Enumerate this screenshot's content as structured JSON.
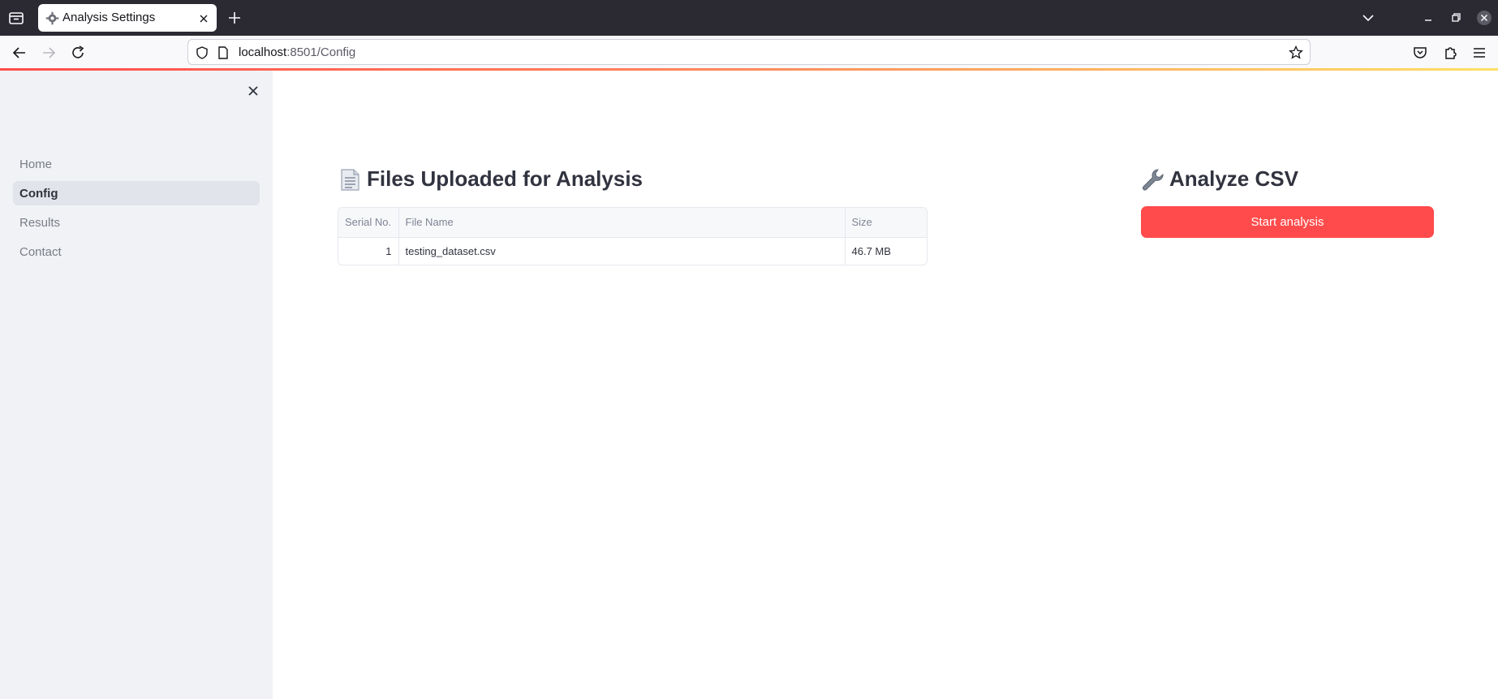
{
  "browser": {
    "tab_title": "Analysis Settings",
    "url_host": "localhost",
    "url_rest": ":8501/Config"
  },
  "sidebar": {
    "items": [
      {
        "label": "Home",
        "active": false
      },
      {
        "label": "Config",
        "active": true
      },
      {
        "label": "Results",
        "active": false
      },
      {
        "label": "Contact",
        "active": false
      }
    ]
  },
  "files_section": {
    "title": "Files Uploaded for Analysis",
    "icon": "page-icon",
    "columns": [
      "Serial No.",
      "File Name",
      "Size"
    ],
    "rows": [
      {
        "serial": "1",
        "name": "testing_dataset.csv",
        "size": "46.7 MB"
      }
    ]
  },
  "analyze_section": {
    "title": "Analyze CSV",
    "icon": "wrench-icon",
    "button_label": "Start analysis"
  },
  "colors": {
    "accent": "#ff4b4b",
    "sidebar_bg": "#f0f2f6",
    "text": "#31333f"
  }
}
